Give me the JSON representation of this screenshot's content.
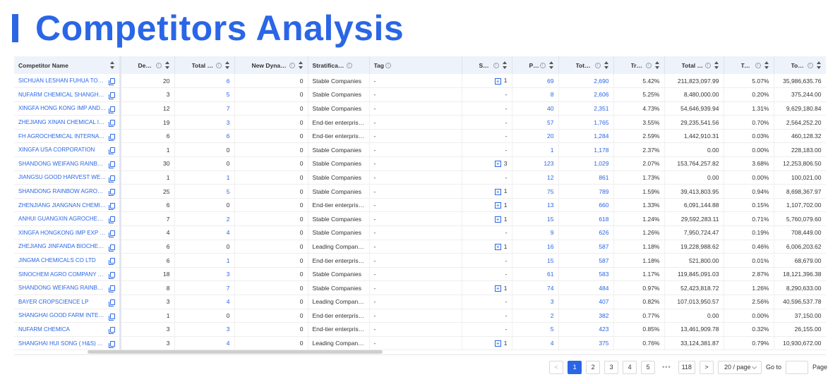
{
  "page": {
    "title": "Competitors Analysis"
  },
  "table": {
    "columns": [
      {
        "label": "Competitor Name",
        "info": false
      },
      {
        "label": "Destination",
        "info": true
      },
      {
        "label": "Total Dyna...",
        "info": true
      },
      {
        "label": "New Dynamic N...",
        "info": true
      },
      {
        "label": "Stratification",
        "info": true
      },
      {
        "label": "Tag",
        "info": true
      },
      {
        "label": "Specificatio...",
        "info": true
      },
      {
        "label": "Purch...",
        "info": true
      },
      {
        "label": "Total Trad...",
        "info": true
      },
      {
        "label": "Trades ...",
        "info": true
      },
      {
        "label": "Total Price",
        "info": true
      },
      {
        "label": "Total Pri...",
        "info": true
      },
      {
        "label": "Total Qua...",
        "info": true
      }
    ],
    "rows": [
      [
        "SICHUAN LESHAN FUHUA TONGDA...",
        "20",
        "6",
        "0",
        "Stable Companies",
        "-",
        "1",
        "69",
        "2,690",
        "5.42%",
        "211,823,097.99",
        "5.07%",
        "35,986,635.76"
      ],
      [
        "NUFARM CHEMICAL SHANGHAI C...",
        "3",
        "5",
        "0",
        "Stable Companies",
        "-",
        "-",
        "8",
        "2,606",
        "5.25%",
        "8,480,000.00",
        "0.20%",
        "375,244.00"
      ],
      [
        "XINGFA HONG KONG IMP AND EX...",
        "12",
        "7",
        "0",
        "Stable Companies",
        "-",
        "-",
        "40",
        "2,351",
        "4.73%",
        "54,646,939.94",
        "1.31%",
        "9,629,180.84"
      ],
      [
        "ZHEJIANG XINAN CHEMICAL IND...",
        "19",
        "3",
        "0",
        "End-tier enterprises",
        "-",
        "-",
        "57",
        "1,765",
        "3.55%",
        "29,235,541.56",
        "0.70%",
        "2,564,252.20"
      ],
      [
        "FH AGROCHEMICAL INTERNATIO...",
        "6",
        "6",
        "0",
        "End-tier enterprises",
        "-",
        "-",
        "20",
        "1,284",
        "2.59%",
        "1,442,910.31",
        "0.03%",
        "460,128.32"
      ],
      [
        "XINGFA USA CORPORATION",
        "1",
        "0",
        "0",
        "Stable Companies",
        "-",
        "-",
        "1",
        "1,178",
        "2.37%",
        "0.00",
        "0.00%",
        "228,183.00"
      ],
      [
        "SHANDONG WEIFANG RAINBOW C...",
        "30",
        "0",
        "0",
        "Stable Companies",
        "-",
        "3",
        "123",
        "1,029",
        "2.07%",
        "153,764,257.82",
        "3.68%",
        "12,253,806.50"
      ],
      [
        "JIANGSU GOOD HARVEST WEIEN ...",
        "1",
        "1",
        "0",
        "Stable Companies",
        "-",
        "-",
        "12",
        "861",
        "1.73%",
        "0.00",
        "0.00%",
        "100,021.00"
      ],
      [
        "SHANDONG RAINBOW AGROSCIE...",
        "25",
        "5",
        "0",
        "Stable Companies",
        "-",
        "1",
        "75",
        "789",
        "1.59%",
        "39,413,803.95",
        "0.94%",
        "8,698,367.97"
      ],
      [
        "ZHENJIANG JIANGNAN CHEMICA...",
        "6",
        "0",
        "0",
        "End-tier enterprises",
        "-",
        "1",
        "13",
        "660",
        "1.33%",
        "6,091,144.88",
        "0.15%",
        "1,107,702.00"
      ],
      [
        "ANHUI GUANGXIN AGROCHEMICA...",
        "7",
        "2",
        "0",
        "Stable Companies",
        "-",
        "1",
        "15",
        "618",
        "1.24%",
        "29,592,283.11",
        "0.71%",
        "5,760,079.60"
      ],
      [
        "XINGFA HONGKONG IMP EXP LIMI...",
        "4",
        "4",
        "0",
        "Stable Companies",
        "-",
        "-",
        "9",
        "626",
        "1.26%",
        "7,950,724.47",
        "0.19%",
        "708,449.00"
      ],
      [
        "ZHEJIANG JINFANDA BIOCHEMIC...",
        "6",
        "0",
        "0",
        "Leading Companies",
        "-",
        "1",
        "16",
        "587",
        "1.18%",
        "19,228,988.62",
        "0.46%",
        "6,006,203.62"
      ],
      [
        "JINGMA CHEMICALS CO LTD",
        "6",
        "1",
        "0",
        "End-tier enterprises",
        "-",
        "-",
        "15",
        "587",
        "1.18%",
        "521,800.00",
        "0.01%",
        "68,679.00"
      ],
      [
        "SINOCHEM AGRO COMPANY LIMI...",
        "18",
        "3",
        "0",
        "Stable Companies",
        "-",
        "-",
        "61",
        "583",
        "1.17%",
        "119,845,091.03",
        "2.87%",
        "18,121,396.38"
      ],
      [
        "SHANDONG WEIFANG RAINBOW C...",
        "8",
        "7",
        "0",
        "Stable Companies",
        "-",
        "1",
        "74",
        "484",
        "0.97%",
        "52,423,818.72",
        "1.26%",
        "8,290,633.00"
      ],
      [
        "BAYER CROPSCIENCE LP",
        "3",
        "4",
        "0",
        "Leading Companies",
        "-",
        "-",
        "3",
        "407",
        "0.82%",
        "107,013,950.57",
        "2.56%",
        "40,596,537.78"
      ],
      [
        "SHANGHAI GOOD FARM INTERNA...",
        "1",
        "0",
        "0",
        "End-tier enterprises",
        "-",
        "-",
        "2",
        "382",
        "0.77%",
        "0.00",
        "0.00%",
        "37,150.00"
      ],
      [
        "NUFARM CHEMICA",
        "3",
        "3",
        "0",
        "End-tier enterprises",
        "-",
        "-",
        "5",
        "423",
        "0.85%",
        "13,461,909.78",
        "0.32%",
        "26,155.00"
      ],
      [
        "SHANGHAI HUI SONG ( H&S) AGR...",
        "3",
        "4",
        "0",
        "Leading Companies",
        "-",
        "1",
        "4",
        "375",
        "0.76%",
        "33,124,381.87",
        "0.79%",
        "10,930,672.00"
      ]
    ]
  },
  "pagination": {
    "prev": "<",
    "pages": [
      "1",
      "2",
      "3",
      "4",
      "5"
    ],
    "active": "1",
    "ellipsis": "•••",
    "last": "118",
    "next": ">",
    "page_size": "20 / page",
    "goto_label": "Go to",
    "page_label": "Page"
  },
  "colors": {
    "accent": "#2a66e6",
    "header_bg": "#eef2fb"
  }
}
